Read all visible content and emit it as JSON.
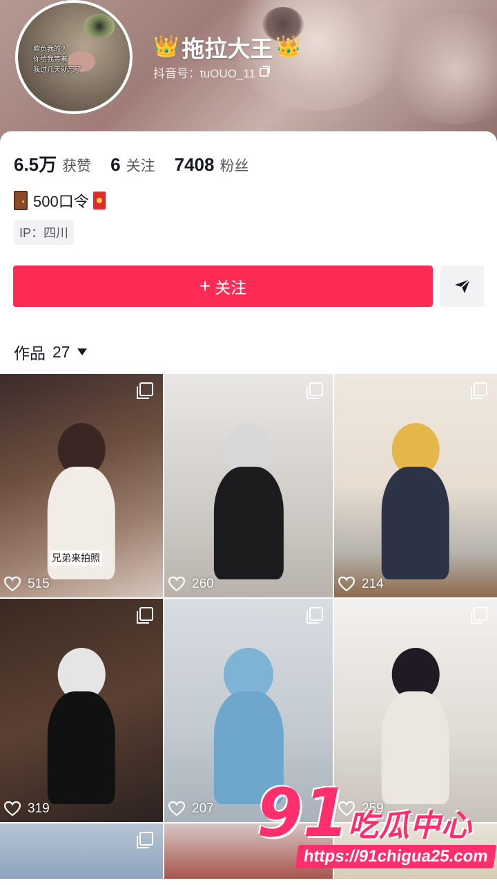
{
  "profile": {
    "avatar_caption": "欺负我的人\n你给我等着\n我过几天就忘了",
    "crown_left": "👑",
    "crown_right": "👑",
    "username": "拖拉大王",
    "douyin_id": "抖音号：tuOUO_11"
  },
  "stats": [
    {
      "value": "6.5万",
      "label": "获赞"
    },
    {
      "value": "6",
      "label": "关注"
    },
    {
      "value": "7408",
      "label": "粉丝"
    }
  ],
  "bio": {
    "text": "500口令"
  },
  "ip_location": "IP：四川",
  "actions": {
    "follow_label": "关注",
    "follow_icon": "+"
  },
  "works": {
    "label": "作品",
    "count": "27"
  },
  "tiles": [
    {
      "likes": "515",
      "overlay_text": "兄弟来拍照"
    },
    {
      "likes": "260"
    },
    {
      "likes": "214"
    },
    {
      "likes": "319"
    },
    {
      "likes": "207"
    },
    {
      "likes": "259"
    },
    {
      "likes": ""
    },
    {
      "likes": ""
    },
    {
      "likes": ""
    }
  ],
  "watermark": {
    "logo": "91",
    "name": "吃瓜中心",
    "url": "https://91chigua25.com"
  },
  "colors": {
    "accent": "#fe2c55",
    "watermark": "#ff2f6d"
  }
}
